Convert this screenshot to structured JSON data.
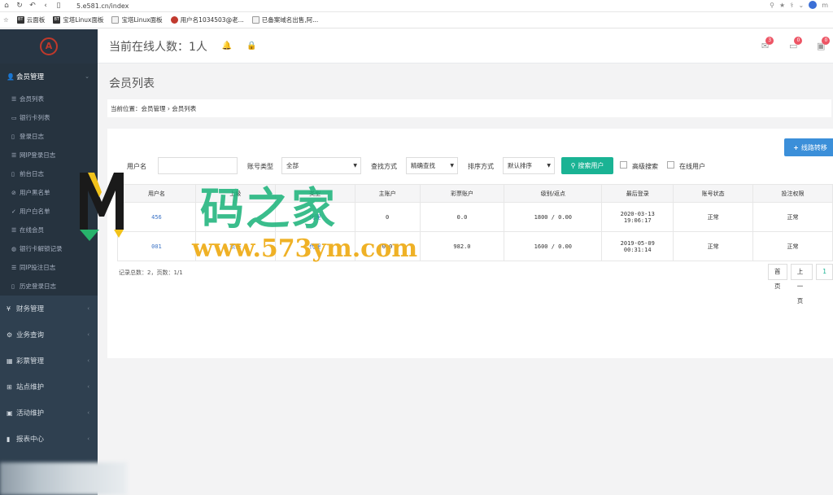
{
  "browser": {
    "url": "5.e581.cn/index",
    "profile_letter": "m",
    "bookmarks": [
      {
        "icon": "BT",
        "label": "云面板"
      },
      {
        "icon": "BT",
        "label": "宝塔Linux面板"
      },
      {
        "icon": "doc",
        "label": "宝塔Linux面板"
      },
      {
        "icon": "red",
        "label": "用户名1034503@老..."
      },
      {
        "icon": "doc",
        "label": "已备案域名出售,阿..."
      }
    ]
  },
  "sidebar": {
    "groups": [
      {
        "icon": "👤",
        "label": "会员管理",
        "expanded": true
      },
      {
        "icon": "¥",
        "label": "财务管理"
      },
      {
        "icon": "⚙",
        "label": "业务查询"
      },
      {
        "icon": "▦",
        "label": "彩票管理"
      },
      {
        "icon": "⊞",
        "label": "站点维护"
      },
      {
        "icon": "▣",
        "label": "活动维护"
      },
      {
        "icon": "▮",
        "label": "报表中心"
      }
    ],
    "sub_items": [
      {
        "icon": "☰",
        "label": "会员列表"
      },
      {
        "icon": "▭",
        "label": "银行卡列表"
      },
      {
        "icon": "▯",
        "label": "登录日志"
      },
      {
        "icon": "☰",
        "label": "网IP登录日志"
      },
      {
        "icon": "▯",
        "label": "前台日志"
      },
      {
        "icon": "⊘",
        "label": "用户黑名单"
      },
      {
        "icon": "✓",
        "label": "用户白名单"
      },
      {
        "icon": "☰",
        "label": "在线会员"
      },
      {
        "icon": "◍",
        "label": "银行卡解锁记录"
      },
      {
        "icon": "☰",
        "label": "同IP投注日志"
      },
      {
        "icon": "▯",
        "label": "历史登录日志"
      }
    ]
  },
  "header": {
    "online_text": "当前在线人数：1人",
    "badges": [
      "3",
      "0",
      "0"
    ]
  },
  "content": {
    "page_title": "会员列表",
    "breadcrumb": "当前位置：会员管理 › 会员列表",
    "transfer_label": "线路转移",
    "filters": {
      "username_label": "用户名",
      "username_value": "",
      "account_type_label": "账号类型",
      "account_type_value": "全部",
      "search_mode_label": "查找方式",
      "search_mode_value": "精确查找",
      "sort_label": "排序方式",
      "sort_value": "默认排序",
      "search_button": "搜索用户",
      "advanced_label": "高级搜索",
      "online_label": "在线用户"
    },
    "table": {
      "columns": [
        "用户名",
        "上级",
        "类型",
        "主账户",
        "彩票账户",
        "级别/返点",
        "最后登录",
        "账号状态",
        "投注权限"
      ],
      "rows": [
        {
          "username": "456",
          "parent": "",
          "type": "代理",
          "main": "0",
          "lottery": "0.0",
          "level": "1800 / 0.00",
          "last_login_date": "2020-03-13",
          "last_login_time": "19:06:17",
          "status": "正常",
          "permission": "正常"
        },
        {
          "username": "001",
          "parent": "点击",
          "type": "代理",
          "main": "0.0",
          "lottery": "982.0",
          "level": "1600 / 0.00",
          "last_login_date": "2019-05-09",
          "last_login_time": "00:31:14",
          "status": "正常",
          "permission": "正常"
        }
      ]
    },
    "records": "记录总数：2，页数：1/1",
    "pager": {
      "first": "首页",
      "prev": "上一页",
      "page": "1"
    }
  },
  "watermark": {
    "cn": "码之家",
    "url": "www.573ym.com"
  },
  "colors": {
    "sidebar": "#2f4050",
    "search_button": "#1ab394",
    "transfer_button": "#3b8fd9",
    "badge": "#ed5565"
  }
}
